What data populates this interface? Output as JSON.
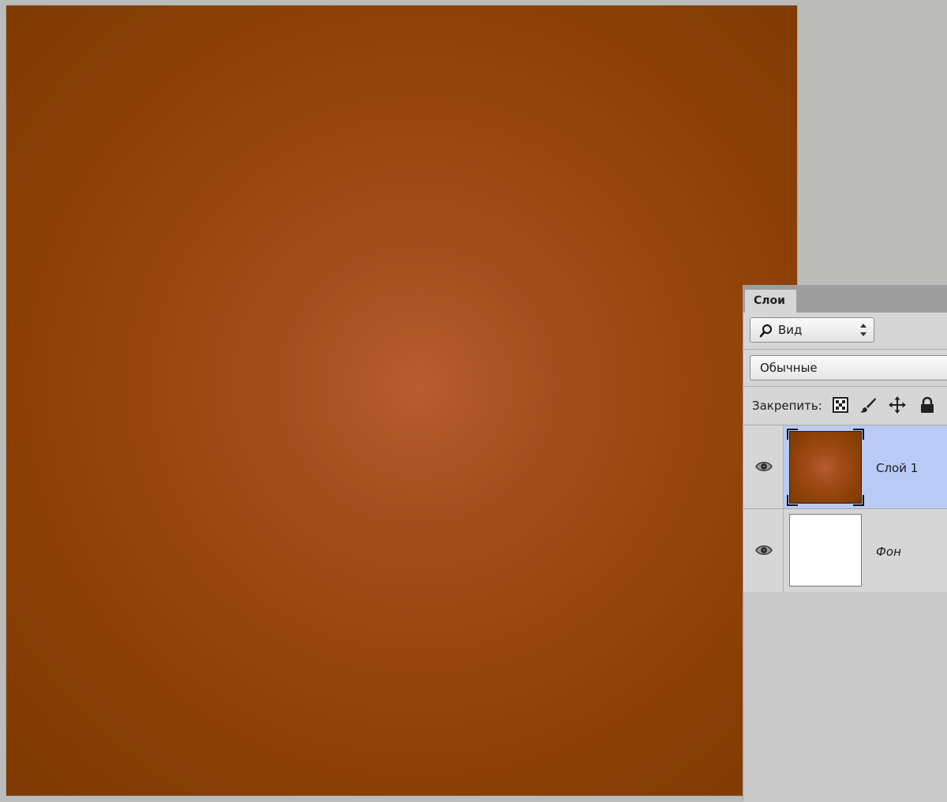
{
  "panel": {
    "tab_label": "Слои",
    "filter": {
      "label": "Вид",
      "icon": "search-icon"
    },
    "blend_mode": "Обычные",
    "lock": {
      "label": "Закрепить:",
      "icons": [
        "lock-transparency-icon",
        "lock-brush-icon",
        "lock-move-icon",
        "lock-all-icon"
      ]
    },
    "layers": [
      {
        "name": "Слой 1",
        "selected": true,
        "visible": true
      },
      {
        "name": "Фон",
        "selected": false,
        "visible": true
      }
    ]
  },
  "colors": {
    "document_center": "#b95d2e",
    "document_edge": "#7d3a02",
    "selection": "#b7cbf5",
    "panel_bg": "#d6d6d6"
  }
}
